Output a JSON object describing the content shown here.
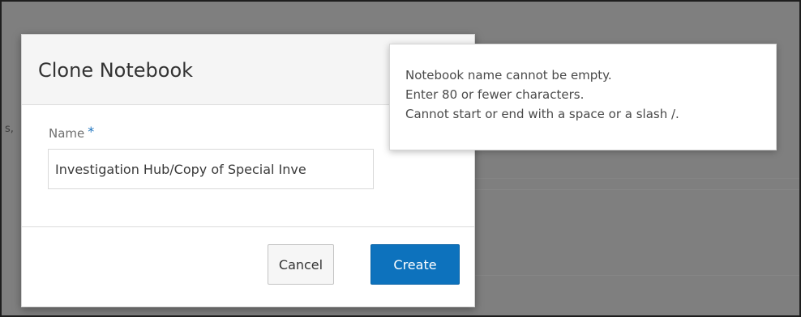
{
  "dialog": {
    "title": "Clone Notebook",
    "name_label": "Name",
    "required_marker": "*",
    "name_value": "Investigation Hub/Copy of Special Inve",
    "cancel_label": "Cancel",
    "create_label": "Create"
  },
  "tooltip": {
    "lines": [
      "Notebook name cannot be empty.",
      "Enter 80 or fewer characters.",
      "Cannot start or end with a space or a slash /."
    ]
  },
  "background": {
    "fragment": "s,"
  },
  "colors": {
    "primary": "#0d72bd",
    "required": "#1b72be",
    "overlay": "#7f7f7f"
  }
}
